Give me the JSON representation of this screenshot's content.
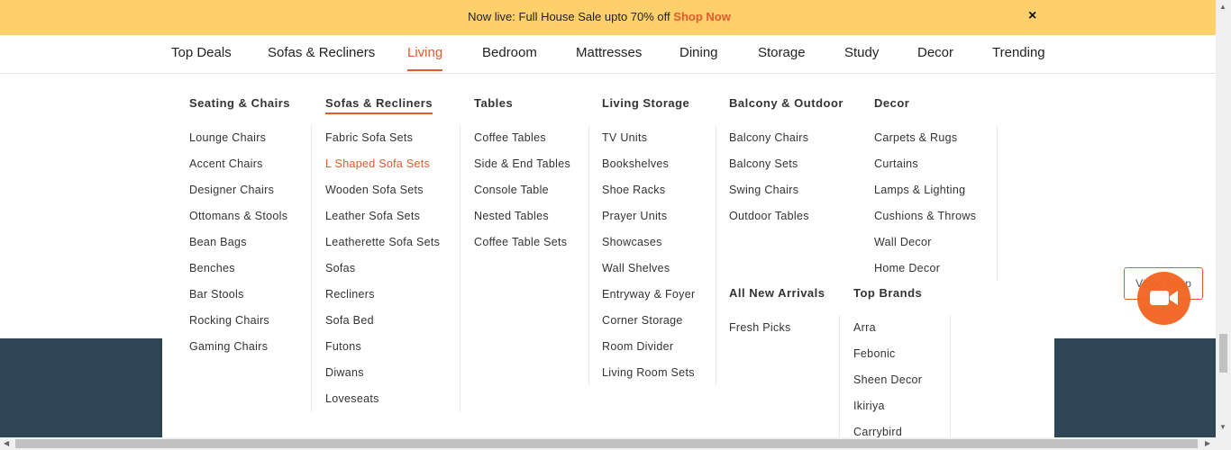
{
  "banner": {
    "text": "Now live: Full House Sale upto 70% off",
    "link": "Shop Now",
    "close": "×"
  },
  "nav": [
    "Top Deals",
    "Sofas & Recliners",
    "Living",
    "Bedroom",
    "Mattresses",
    "Dining",
    "Storage",
    "Study",
    "Decor",
    "Trending"
  ],
  "nav_active": "Living",
  "menu": {
    "seating": {
      "title": "Seating & Chairs",
      "items": [
        "Lounge Chairs",
        "Accent Chairs",
        "Designer Chairs",
        "Ottomans & Stools",
        "Bean Bags",
        "Benches",
        "Bar Stools",
        "Rocking Chairs",
        "Gaming Chairs"
      ]
    },
    "sofas": {
      "title": "Sofas & Recliners",
      "items": [
        "Fabric Sofa Sets",
        "L Shaped Sofa Sets",
        "Wooden Sofa Sets",
        "Leather Sofa Sets",
        "Leatherette Sofa Sets",
        "Sofas",
        "Recliners",
        "Sofa Bed",
        "Futons",
        "Diwans",
        "Loveseats"
      ]
    },
    "tables": {
      "title": "Tables",
      "items": [
        "Coffee Tables",
        "Side & End Tables",
        "Console Table",
        "Nested Tables",
        "Coffee Table Sets"
      ]
    },
    "storage": {
      "title": "Living Storage",
      "items": [
        "TV Units",
        "Bookshelves",
        "Shoe Racks",
        "Prayer Units",
        "Showcases",
        "Wall Shelves",
        "Entryway & Foyer",
        "Corner Storage",
        "Room Divider",
        "Living Room Sets"
      ]
    },
    "balcony": {
      "title": "Balcony & Outdoor",
      "items": [
        "Balcony Chairs",
        "Balcony Sets",
        "Swing Chairs",
        "Outdoor Tables"
      ]
    },
    "decor": {
      "title": "Decor",
      "items": [
        "Carpets & Rugs",
        "Curtains",
        "Lamps & Lighting",
        "Cushions & Throws",
        "Wall Decor",
        "Home Decor"
      ]
    },
    "arrivals": {
      "title": "All New Arrivals",
      "items": [
        "Fresh Picks"
      ]
    },
    "brands": {
      "title": "Top Brands",
      "items": [
        "Arra",
        "Febonic",
        "Sheen Decor",
        "Ikiriya",
        "Carrybird"
      ]
    }
  },
  "active_link": "L Shaped Sofa Sets",
  "video_shop": "Video Shop",
  "colors": {
    "accent": "#e4592d",
    "banner": "#fed06b",
    "footer": "#2d4555"
  }
}
